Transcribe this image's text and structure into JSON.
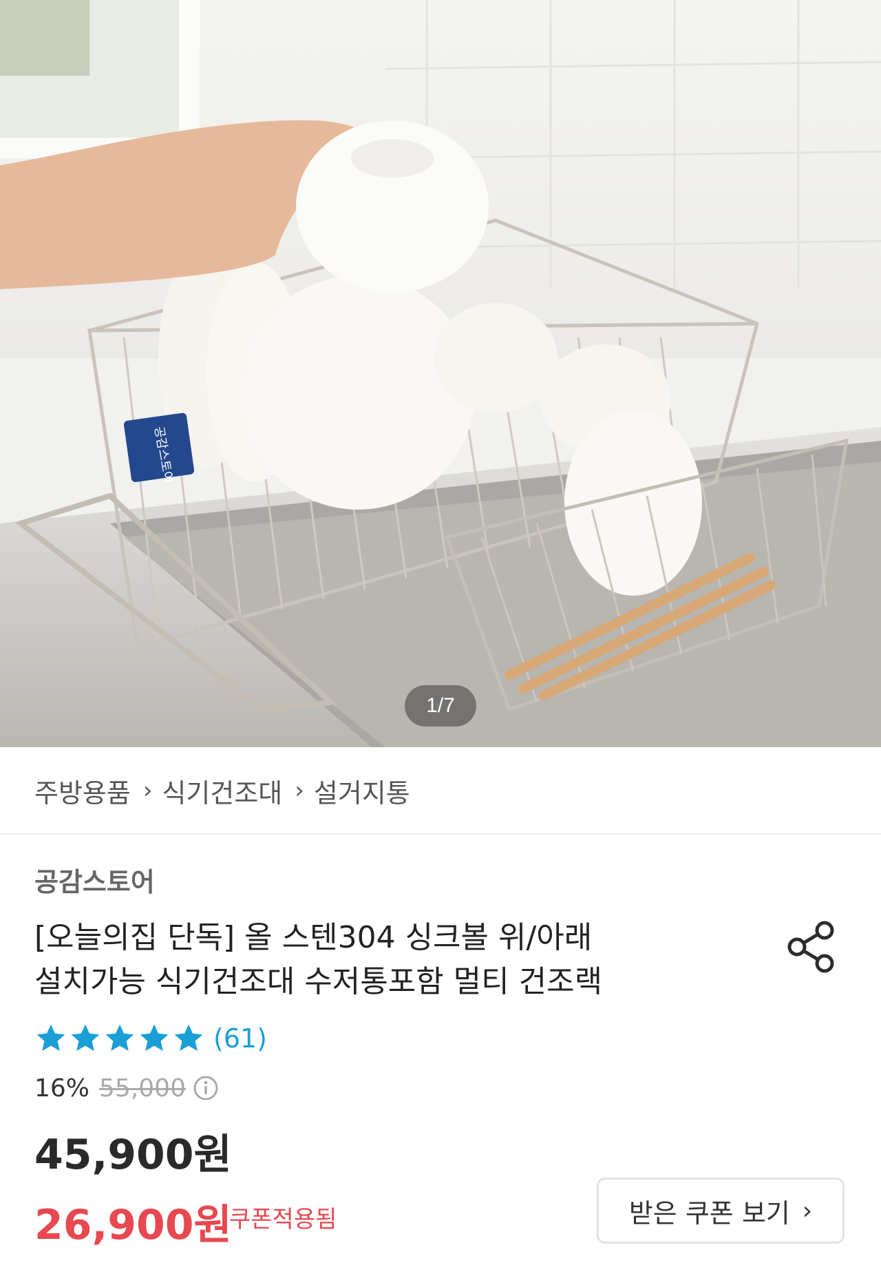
{
  "gallery": {
    "current": 1,
    "total": 7,
    "indicator": "1/7",
    "sticker_text": "공감스토어"
  },
  "breadcrumb": [
    "주방용품",
    "식기건조대",
    "설거지통"
  ],
  "product": {
    "brand": "공감스토어",
    "title_line1": "[오늘의집 단독] 올 스텐304 싱크볼 위/아래",
    "title_line2": "설치가능 식기건조대 수저통포함 멀티 건조랙",
    "rating": 5,
    "review_count": "(61)",
    "discount_rate": "16%",
    "original_price": "55,000",
    "price": "45,900원",
    "coupon_price": "26,900원",
    "coupon_applied": "쿠폰적용됨",
    "coupon_button": "받은 쿠폰 보기"
  },
  "colors": {
    "star": "#1a9fd6",
    "coupon_red": "#e8484f",
    "review_blue": "#1a9fd6"
  },
  "icons": [
    "share-icon",
    "info-icon",
    "star-icon",
    "chevron-right-icon"
  ]
}
